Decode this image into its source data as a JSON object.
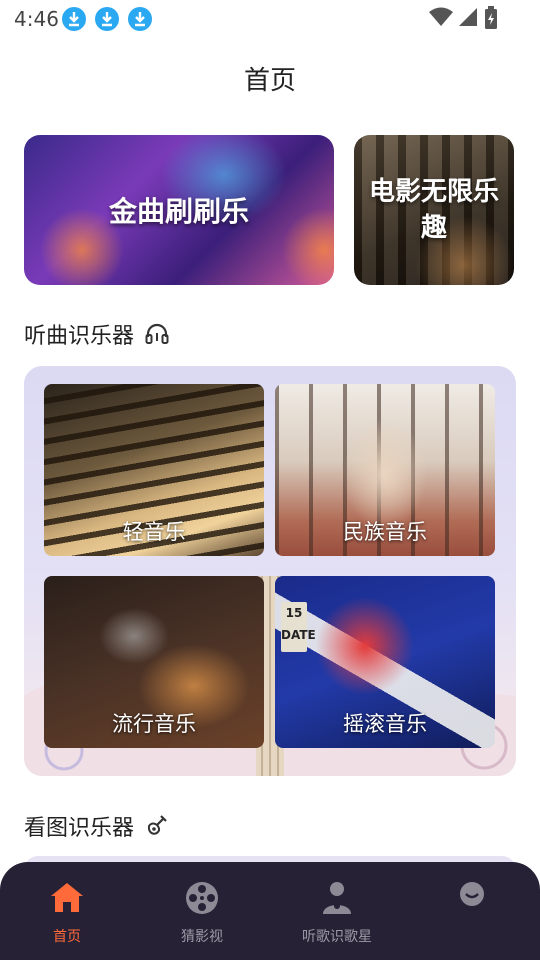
{
  "status_bar": {
    "time": "4:46"
  },
  "page": {
    "title": "首页"
  },
  "banners": [
    {
      "label": "金曲刷刷乐"
    },
    {
      "label": "电影无限乐趣"
    }
  ],
  "sections": {
    "instruments": {
      "title": "听曲识乐器",
      "icon": "headphone-icon"
    },
    "images": {
      "title": "看图识乐器",
      "icon": "guitar-icon"
    }
  },
  "cards": [
    {
      "label": "轻音乐"
    },
    {
      "label": "民族音乐"
    },
    {
      "label": "流行音乐"
    },
    {
      "label": "摇滚音乐",
      "badge": "15 DATE"
    }
  ],
  "nav": {
    "items": [
      {
        "label": "首页",
        "icon": "home-icon",
        "active": true
      },
      {
        "label": "猜影视",
        "icon": "film-reel-icon",
        "active": false
      },
      {
        "label": "听歌识歌星",
        "icon": "singer-icon",
        "active": false
      },
      {
        "label": "",
        "icon": "profile-icon",
        "active": false
      }
    ]
  },
  "colors": {
    "accent": "#ff6a3a",
    "nav_bg": "#262135",
    "download_blue": "#2aa8f2"
  }
}
